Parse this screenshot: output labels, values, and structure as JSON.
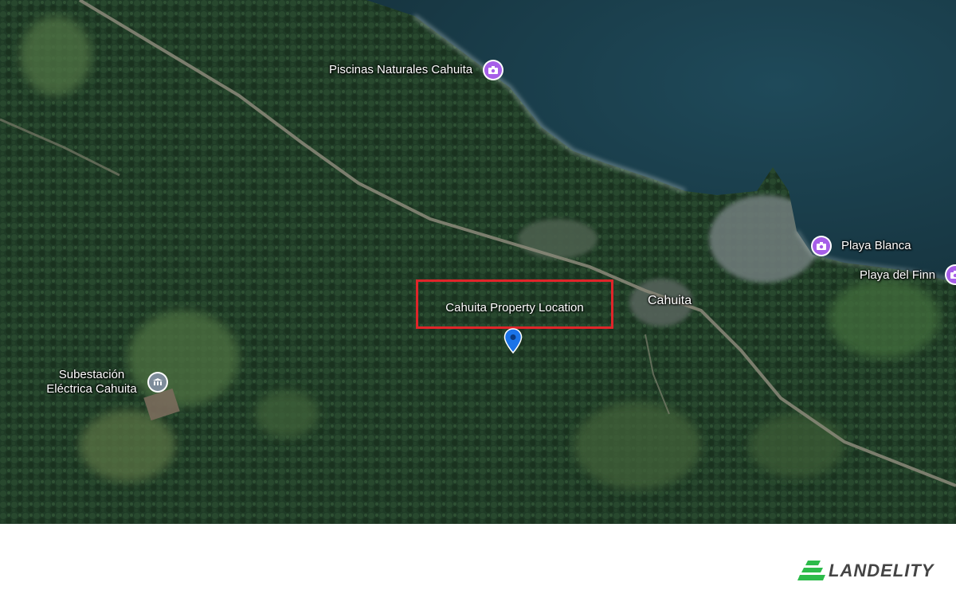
{
  "map": {
    "labels": {
      "piscinas": "Piscinas Naturales Cahuita",
      "playa_blanca": "Playa Blanca",
      "playa_del_finn": "Playa del Finn",
      "cahuita_town": "Cahuita",
      "subestacion_line1": "Subestación",
      "subestacion_line2": "Eléctrica Cahuita"
    },
    "highlight": {
      "label": "Cahuita Property Location"
    },
    "icons": {
      "poi_attraction": "camera-icon",
      "poi_utility": "building-icon",
      "marker": "location-pin-icon"
    },
    "colors": {
      "highlight_border": "#e0252a",
      "attraction_icon": "#a65ee8",
      "utility_icon": "#7d8c9a",
      "pin": "#1a73e8"
    }
  },
  "footer": {
    "logo_text": "LANDELITY",
    "logo_color": "#2dbb4a"
  }
}
